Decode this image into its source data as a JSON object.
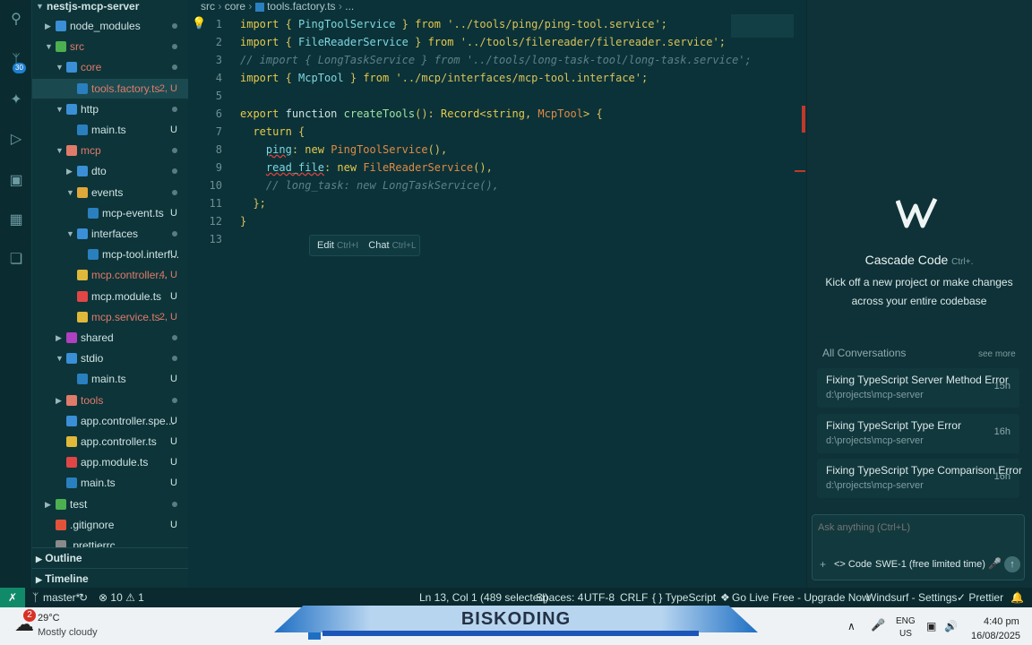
{
  "explorer": {
    "root": "nestjs-mcp-server",
    "rows": [
      {
        "label": "node_modules",
        "status": "dot",
        "color": "#cfe3e3"
      },
      {
        "label": "src",
        "status": "dot",
        "color": "#e07b6a"
      },
      {
        "label": "core",
        "status": "dot",
        "color": "#e07b6a"
      },
      {
        "label": "tools.factory.ts",
        "status": "2, U",
        "color": "#e07b6a"
      },
      {
        "label": "http",
        "status": "dot",
        "color": "#cfe3e3"
      },
      {
        "label": "main.ts",
        "status": "U",
        "color": "#cfe3e3"
      },
      {
        "label": "mcp",
        "status": "dot",
        "color": "#e07b6a"
      },
      {
        "label": "dto",
        "status": "dot",
        "color": "#cfe3e3"
      },
      {
        "label": "events",
        "status": "dot",
        "color": "#cfe3e3"
      },
      {
        "label": "mcp-event.ts",
        "status": "U",
        "color": "#cfe3e3"
      },
      {
        "label": "interfaces",
        "status": "dot",
        "color": "#cfe3e3"
      },
      {
        "label": "mcp-tool.interf...",
        "status": "U",
        "color": "#cfe3e3"
      },
      {
        "label": "mcp.controller...",
        "status": "4, U",
        "color": "#e07b6a"
      },
      {
        "label": "mcp.module.ts",
        "status": "U",
        "color": "#cfe3e3"
      },
      {
        "label": "mcp.service.ts",
        "status": "2, U",
        "color": "#e07b6a"
      },
      {
        "label": "shared",
        "status": "dot",
        "color": "#cfe3e3"
      },
      {
        "label": "stdio",
        "status": "dot",
        "color": "#cfe3e3"
      },
      {
        "label": "main.ts",
        "status": "U",
        "color": "#cfe3e3"
      },
      {
        "label": "tools",
        "status": "dot",
        "color": "#e07b6a"
      },
      {
        "label": "app.controller.spe...",
        "status": "U",
        "color": "#cfe3e3"
      },
      {
        "label": "app.controller.ts",
        "status": "U",
        "color": "#cfe3e3"
      },
      {
        "label": "app.module.ts",
        "status": "U",
        "color": "#cfe3e3"
      },
      {
        "label": "main.ts",
        "status": "U",
        "color": "#cfe3e3"
      },
      {
        "label": "test",
        "status": "dot",
        "color": "#cfe3e3"
      },
      {
        "label": ".gitignore",
        "status": "U",
        "color": "#cfe3e3"
      },
      {
        "label": ".prettierrc",
        "status": "",
        "color": "#cfe3e3"
      }
    ],
    "outline": "Outline",
    "timeline": "Timeline"
  },
  "breadcrumb": {
    "a": "src",
    "b": "core",
    "c": "tools.factory.ts",
    "d": "..."
  },
  "editor": {
    "line_numbers": [
      "1",
      "2",
      "3",
      "4",
      "5",
      "6",
      "7",
      "8",
      "9",
      "10",
      "11",
      "12",
      "13"
    ],
    "hint_edit": "Edit",
    "hint_edit_key": "Ctrl+I",
    "hint_chat": "Chat",
    "hint_chat_key": "Ctrl+L"
  },
  "cascade": {
    "title": "Cascade Code",
    "shortcut": "Ctrl+.",
    "subtitle1": "Kick off a new project or make changes",
    "subtitle2": "across your entire codebase",
    "all_conversations": "All Conversations",
    "see_more": "see more",
    "conversations": [
      {
        "title": "Fixing TypeScript Server Method Error",
        "path": "d:\\projects\\mcp-server",
        "age": "15h"
      },
      {
        "title": "Fixing TypeScript Type Error",
        "path": "d:\\projects\\mcp-server",
        "age": "16h"
      },
      {
        "title": "Fixing TypeScript Type Comparison Error",
        "path": "d:\\projects\\mcp-server",
        "age": "16h"
      }
    ],
    "ask_placeholder": "Ask anything (Ctrl+L)",
    "plus": "+",
    "code_mode": "<> Code",
    "model": "SWE-1 (free limited time)"
  },
  "status": {
    "branch": "master*",
    "problems": "⊗ 10 ⚠ 1",
    "cursor": "Ln 13, Col 1 (489 selected)",
    "spaces": "Spaces: 4",
    "encoding": "UTF-8",
    "eol": "CRLF",
    "lang": "{ } TypeScript",
    "golive": "Go Live",
    "upgrade": "Free - Upgrade Now",
    "windsurf": "Windsurf - Settings",
    "prettier": "✓ Prettier"
  },
  "taskbar": {
    "weather_temp": "29°C",
    "weather_desc": "Mostly cloudy",
    "weather_badge": "2",
    "banner": "BISKODING",
    "lang1": "ENG",
    "lang2": "US",
    "time": "4:40 pm",
    "date": "16/08/2025"
  },
  "activity_badge": "30"
}
